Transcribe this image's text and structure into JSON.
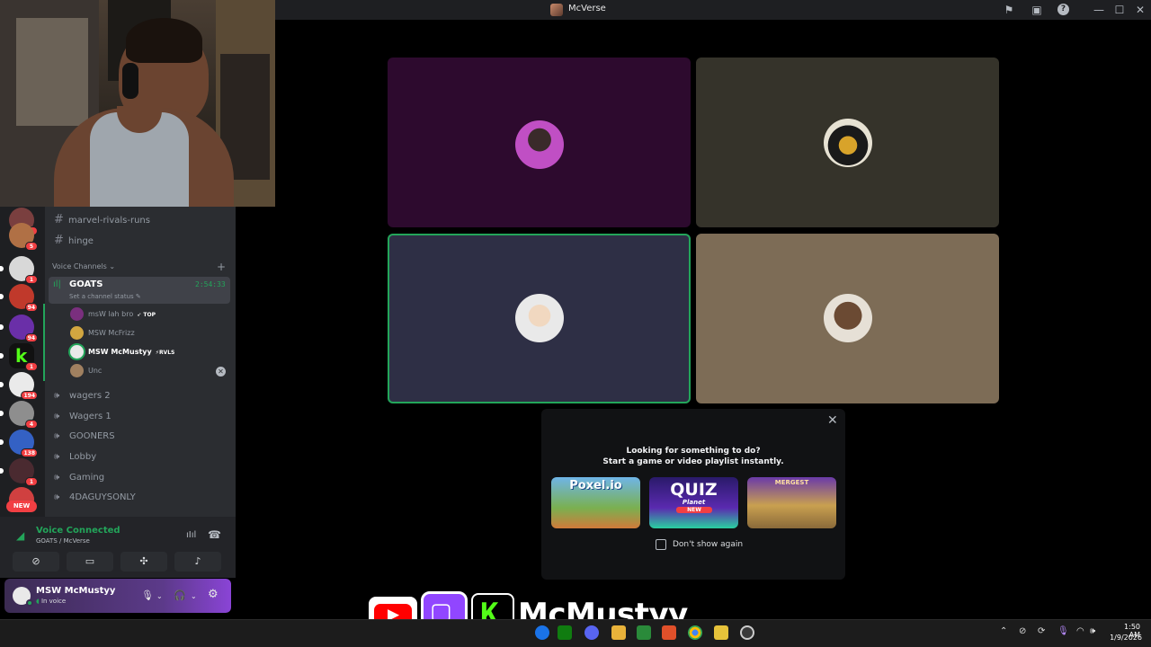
{
  "window": {
    "title": "McVerse",
    "icons": [
      "flag-icon",
      "inbox-icon",
      "help-icon",
      "minimize-icon",
      "maximize-icon",
      "close-icon"
    ]
  },
  "servers": [
    {
      "badge": "1"
    },
    {
      "badge": "5"
    },
    {
      "badge": "1"
    },
    {
      "badge": "94"
    },
    {
      "badge": "94"
    },
    {
      "badge": "1"
    },
    {
      "badge": "194"
    },
    {
      "badge": "4"
    },
    {
      "badge": "138"
    },
    {
      "badge": "1"
    }
  ],
  "server_new_label": "NEW",
  "text_channels": [
    {
      "name": "marvel-rivals-runs"
    },
    {
      "name": "hinge"
    }
  ],
  "voice_section": {
    "header": "Voice Channels",
    "active_channel": {
      "name": "GOATS",
      "status": "Set a channel status",
      "timer": "2:54:33",
      "members": [
        {
          "name": "msW lah bro",
          "tag": "TOP"
        },
        {
          "name": "MSW McFrizz",
          "tag": ""
        },
        {
          "name": "MSW McMustyy",
          "tag": "RVLS"
        },
        {
          "name": "Unc",
          "tag": ""
        }
      ]
    },
    "channels": [
      {
        "name": "wagers 2"
      },
      {
        "name": "Wagers 1"
      },
      {
        "name": "GOONERS"
      },
      {
        "name": "Lobby"
      },
      {
        "name": "Gaming"
      },
      {
        "name": "4DAGUYSONLY"
      }
    ]
  },
  "voice_panel": {
    "title": "Voice Connected",
    "subtitle": "GOATS / McVerse"
  },
  "user": {
    "name": "MSW McMustyy",
    "status": "In voice"
  },
  "video_tiles": [
    {
      "bg": "#2d0a2e"
    },
    {
      "bg": "#35332a"
    },
    {
      "bg": "#2e2f45",
      "speaking": true
    },
    {
      "bg": "#7d6c56"
    }
  ],
  "activity": {
    "line1": "Looking for something to do?",
    "line2": "Start a game or video playlist instantly.",
    "games": [
      {
        "name": "Poxel.io"
      },
      {
        "name": "QUIZ",
        "sub": "Planet",
        "badge": "NEW"
      },
      {
        "name": "MERGEST"
      }
    ],
    "dont_show": "Don't show again"
  },
  "overlay": {
    "streamer_name": "McMustyy"
  },
  "clock": {
    "time": "1:50 AM",
    "date": "1/9/2026"
  },
  "colors": {
    "accent_green": "#23a55a",
    "discord_bg": "#2b2d31",
    "twitch": "#9146ff",
    "kick": "#53fc18",
    "youtube": "#ff0000"
  }
}
